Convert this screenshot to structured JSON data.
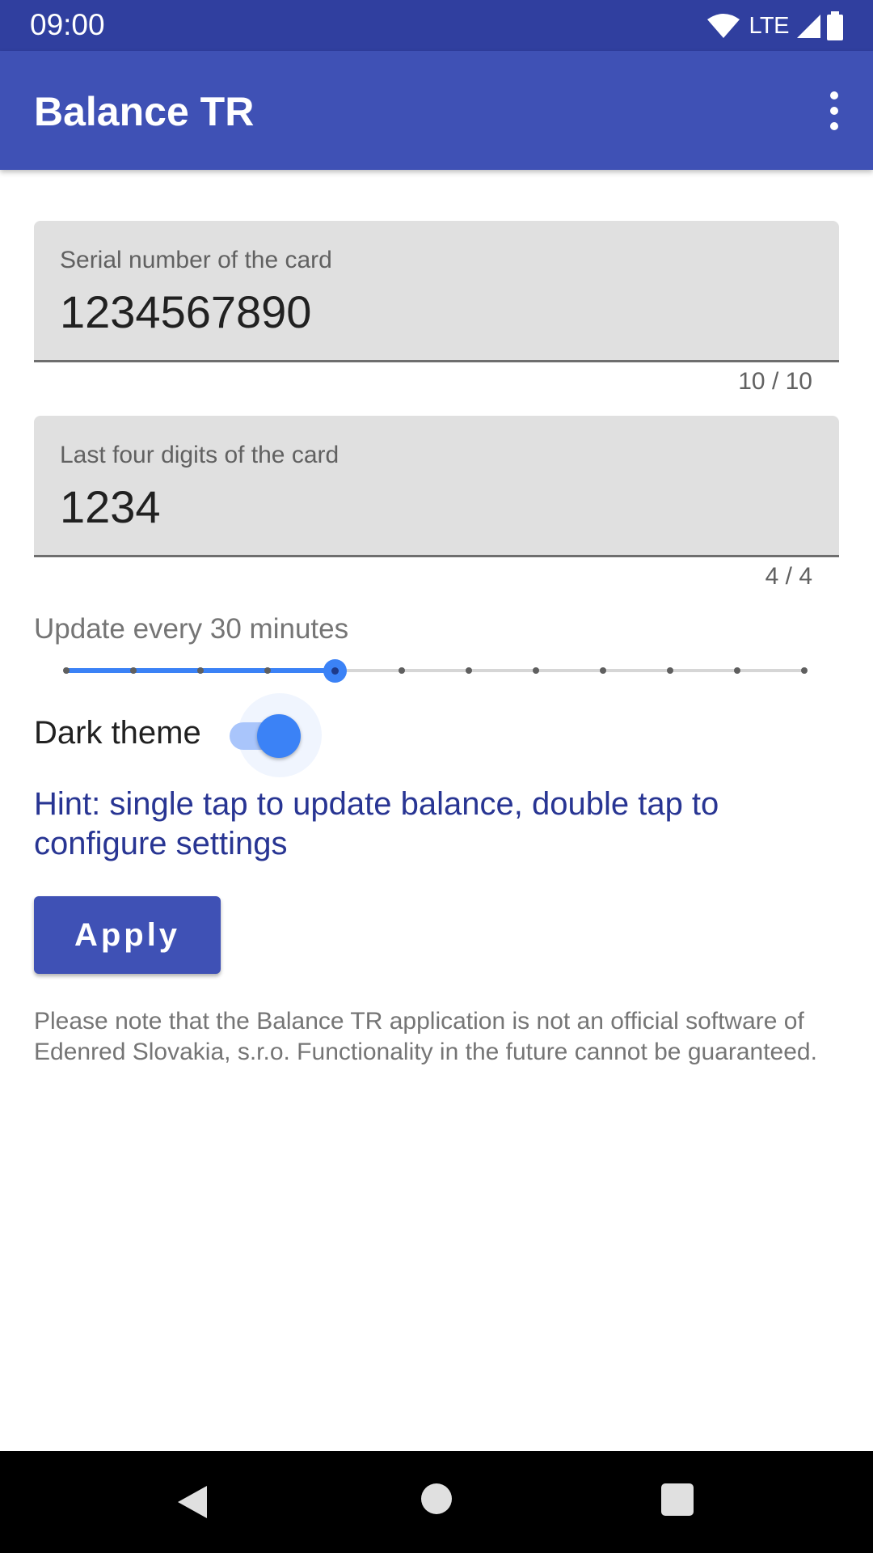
{
  "status_bar": {
    "time": "09:00",
    "network": "LTE",
    "icons": [
      "wifi-icon",
      "lte-signal-icon",
      "battery-icon"
    ]
  },
  "app_bar": {
    "title": "Balance TR",
    "menu_icon": "more-vert-icon"
  },
  "form": {
    "serial": {
      "label": "Serial number of the card",
      "value": "1234567890",
      "counter": "10 / 10"
    },
    "last_four": {
      "label": "Last four digits of the card",
      "value": "1234",
      "counter": "4 / 4"
    },
    "update": {
      "label": "Update every 30 minutes",
      "steps": 12,
      "selected_index": 4
    },
    "dark_theme": {
      "label": "Dark theme",
      "checked": true
    },
    "hint": "Hint: single tap to update balance, double tap to configure settings",
    "apply_label": "Apply",
    "note": "Please note that the Balance TR application is not an official software of Edenred Slovakia, s.r.o. Functionality in the future cannot be guaranteed."
  },
  "nav_bar": {
    "icons": [
      "back-icon",
      "home-icon",
      "recents-icon"
    ]
  },
  "colors": {
    "primary": "#3f51b5",
    "primary_dark": "#303f9f",
    "accent": "#3b82f6",
    "hint_text": "#283593"
  }
}
